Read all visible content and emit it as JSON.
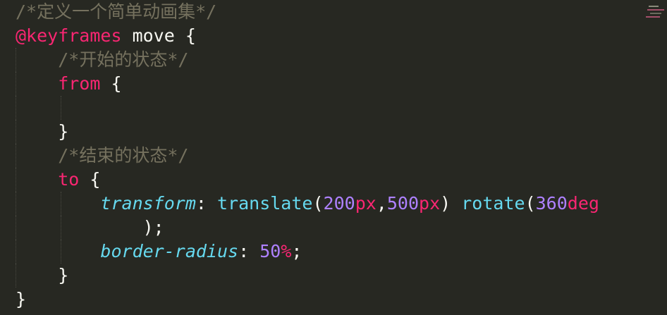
{
  "editor": {
    "theme_colors": {
      "background": "#272822",
      "comment": "#75715e",
      "keyword": "#f92672",
      "property": "#66d9ef",
      "number": "#ae81ff",
      "text": "#f8f8f2"
    },
    "lines": {
      "l1": {
        "comment": "/*定义一个简单动画集*/"
      },
      "l2": {
        "at_rule": "@keyframes",
        "name": " move ",
        "brace": "{"
      },
      "l3": {
        "indent": "    ",
        "comment": "/*开始的状态*/"
      },
      "l4": {
        "indent": "    ",
        "selector": "from",
        "brace": " {"
      },
      "l5": {
        "indent": ""
      },
      "l6": {
        "indent": "    ",
        "brace": "}"
      },
      "l7": {
        "indent": "    ",
        "comment": "/*结束的状态*/"
      },
      "l8": {
        "indent": "    ",
        "selector": "to",
        "brace": " {"
      },
      "l9": {
        "indent": "        ",
        "property": "transform",
        "colon": ": ",
        "fn1": "translate",
        "paren_open1": "(",
        "num1": "200",
        "unit1": "px",
        "comma": ",",
        "num2": "500",
        "unit2": "px",
        "paren_close1": ")",
        "space": " ",
        "fn2": "rotate",
        "paren_open2": "(",
        "num3": "360",
        "unit3": "deg"
      },
      "l10": {
        "indent": "            ",
        "tail": ");"
      },
      "l11": {
        "indent": "        ",
        "property": "border-radius",
        "colon": ": ",
        "num": "50",
        "unit": "%",
        "semi": ";"
      },
      "l12": {
        "indent": "    ",
        "brace": "}"
      },
      "l13": {
        "brace": "}"
      }
    }
  }
}
